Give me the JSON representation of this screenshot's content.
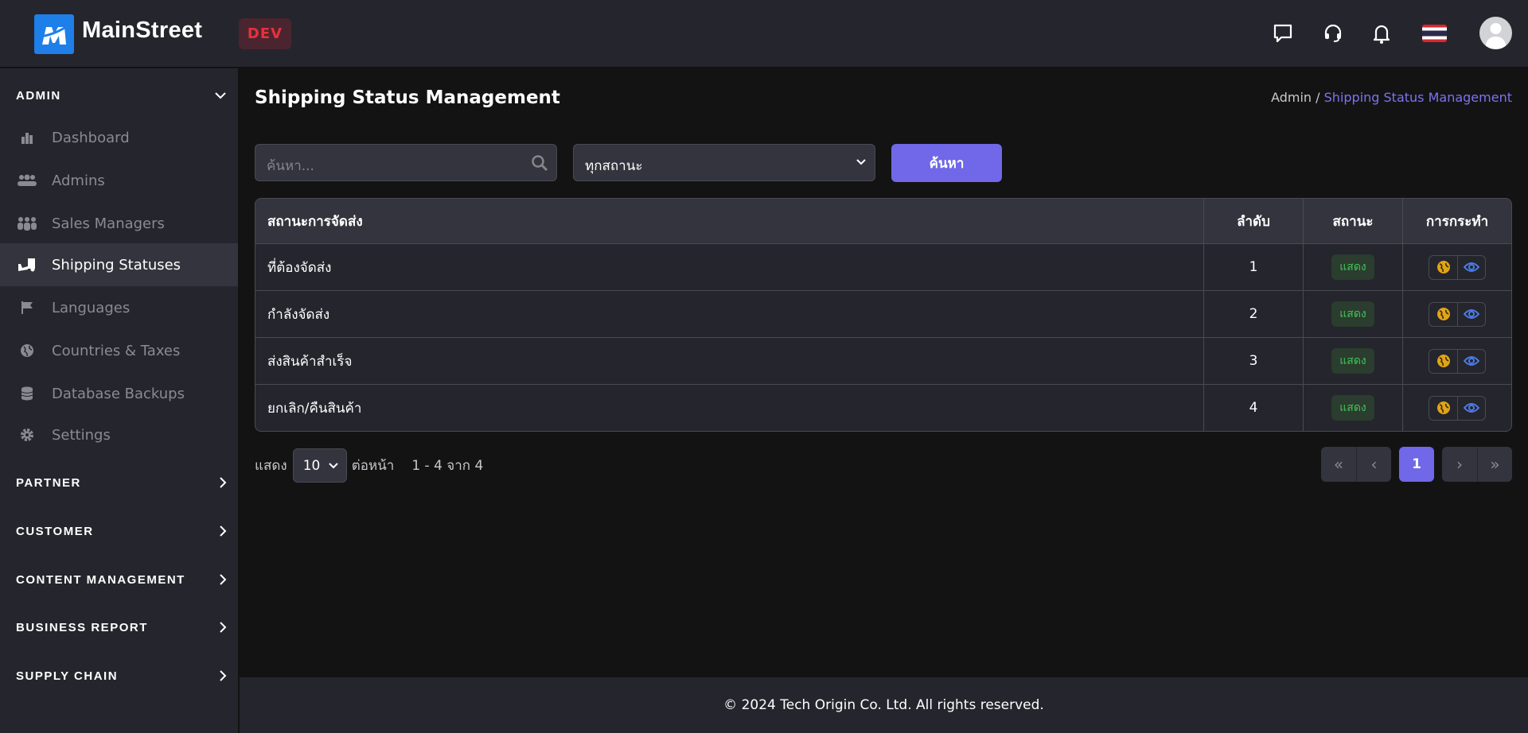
{
  "header": {
    "brand": "MainStreet",
    "env_badge": "DEV",
    "icons": [
      "chat-icon",
      "headset-icon",
      "bell-icon",
      "thai-flag-icon",
      "avatar"
    ]
  },
  "sidebar": {
    "admin_label": "ADMIN",
    "items": [
      {
        "label": "Dashboard",
        "icon": "chart-bar-icon"
      },
      {
        "label": "Admins",
        "icon": "users-icon"
      },
      {
        "label": "Sales Managers",
        "icon": "people-group-icon"
      },
      {
        "label": "Shipping Statuses",
        "icon": "truck-ramp-icon",
        "active": true
      },
      {
        "label": "Languages",
        "icon": "flag-icon"
      },
      {
        "label": "Countries & Taxes",
        "icon": "globe-icon"
      },
      {
        "label": "Database Backups",
        "icon": "database-icon"
      },
      {
        "label": "Settings",
        "icon": "gear-icon"
      }
    ],
    "sections": [
      "PARTNER",
      "CUSTOMER",
      "CONTENT MANAGEMENT",
      "BUSINESS REPORT",
      "SUPPLY CHAIN"
    ]
  },
  "page": {
    "title": "Shipping Status Management",
    "breadcrumb": {
      "root": "Admin",
      "sep": " / ",
      "current": "Shipping Status Management"
    }
  },
  "filters": {
    "search_placeholder": "ค้นหา...",
    "status_select": "ทุกสถานะ",
    "search_button": "ค้นหา"
  },
  "table": {
    "headers": [
      "สถานะการจัดส่ง",
      "ลำดับ",
      "สถานะ",
      "การกระทำ"
    ],
    "rows": [
      {
        "name": "ที่ต้องจัดส่ง",
        "order": "1",
        "status": "แสดง"
      },
      {
        "name": "กำลังจัดส่ง",
        "order": "2",
        "status": "แสดง"
      },
      {
        "name": "ส่งสินค้าสำเร็จ",
        "order": "3",
        "status": "แสดง"
      },
      {
        "name": "ยกเลิก/คืนสินค้า",
        "order": "4",
        "status": "แสดง"
      }
    ]
  },
  "pagination": {
    "show_label": "แสดง",
    "per_page": "10",
    "per_page_label": "ต่อหน้า",
    "range": "1 - 4 จาก 4",
    "current_page": "1"
  },
  "colors": {
    "accent": "#7068e8",
    "badge_green": "#44c15a",
    "dev_red": "#e8303c",
    "translate_icon": "#e0a419",
    "view_icon": "#4a7ce8"
  },
  "footer": {
    "text": "© 2024 Tech Origin Co. Ltd. All rights reserved."
  }
}
